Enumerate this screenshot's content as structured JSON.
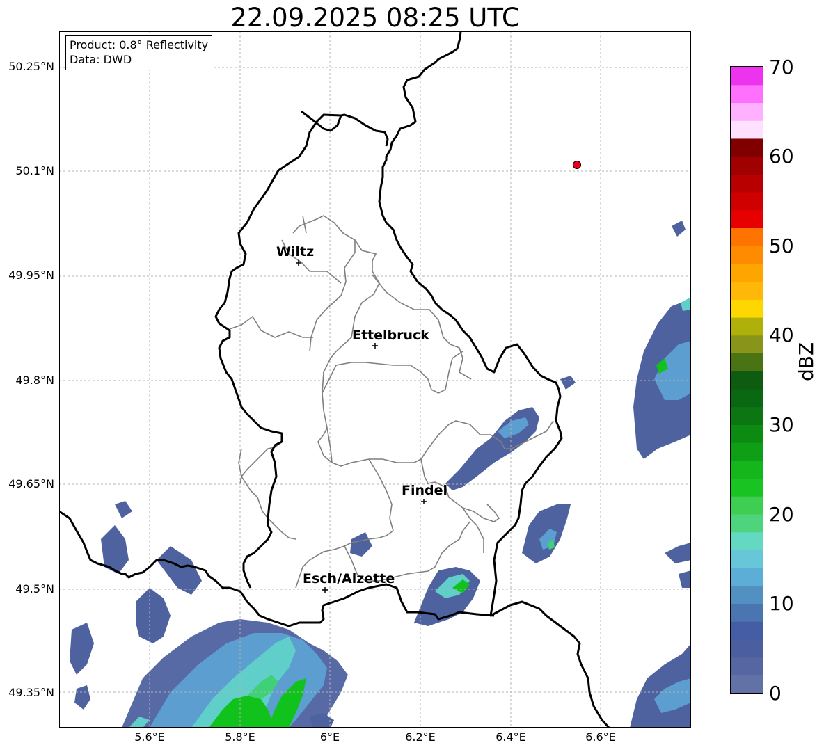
{
  "title": "22.09.2025 08:25 UTC",
  "infobox": {
    "product": "Product: 0.8° Reflectivity",
    "source": "Data: DWD"
  },
  "latitude_labels": [
    "50.25°N",
    "50.1°N",
    "49.95°N",
    "49.8°N",
    "49.65°N",
    "49.5°N",
    "49.35°N"
  ],
  "longitude_labels": [
    "5.6°E",
    "5.8°E",
    "6°E",
    "6.2°E",
    "6.4°E",
    "6.6°E"
  ],
  "cities": [
    {
      "name": "Wiltz"
    },
    {
      "name": "Ettelbruck"
    },
    {
      "name": "Findel"
    },
    {
      "name": "Esch/Alzette"
    }
  ],
  "colorbar": {
    "label": "dBZ",
    "ticks": [
      "70",
      "60",
      "50",
      "40",
      "30",
      "20",
      "10",
      "0"
    ],
    "range": [
      0,
      70
    ],
    "step": 2.5,
    "colors": [
      "#6272a6",
      "#5666a2",
      "#4a5ea0",
      "#445da4",
      "#4a75b0",
      "#5390c2",
      "#5caed6",
      "#67c7d9",
      "#62d9c0",
      "#4ed47c",
      "#3dce52",
      "#19c422",
      "#14b61c",
      "#0f9f16",
      "#0c8a12",
      "#0b7612",
      "#0a6712",
      "#0d5c10",
      "#4a7313",
      "#88941a",
      "#b0b00a",
      "#ffd700",
      "#ffb708",
      "#ffa500",
      "#ff8c00",
      "#ff7400",
      "#e60000",
      "#d00000",
      "#b80000",
      "#a00000",
      "#800000",
      "#ffe0ff",
      "#ffb0ff",
      "#ff70ff",
      "#ee33ee"
    ]
  },
  "map": {
    "lon_range": [
      5.4,
      6.8
    ],
    "lat_range": [
      49.3,
      50.3
    ],
    "grid": true,
    "radar_site_marker_color": "#e8001c",
    "radar_colors": {
      "weak": "#4f62a0",
      "medium": "#5c9ed0",
      "cyan": "#61cfc9",
      "green": "#11c21c",
      "light_green": "#3fd078"
    }
  }
}
